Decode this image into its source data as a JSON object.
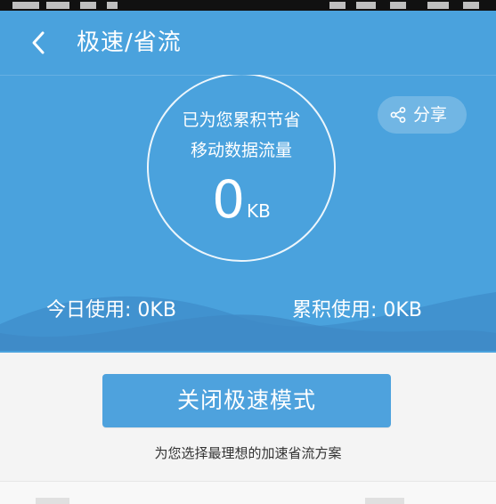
{
  "header": {
    "title": "极速/省流"
  },
  "hero": {
    "saved_line1": "已为您累积节省",
    "saved_line2": "移动数据流量",
    "saved_value": "0",
    "saved_unit": "KB",
    "share_label": "分享",
    "today_usage": "今日使用: 0KB",
    "total_usage": "累积使用: 0KB"
  },
  "actions": {
    "main_button": "关闭极速模式",
    "description": "为您选择最理想的加速省流方案"
  },
  "colors": {
    "primary": "#4aa2dd",
    "button": "#4ea2dd",
    "background": "#f4f4f4"
  },
  "icons": {
    "back": "back-icon",
    "share": "share-icon"
  }
}
